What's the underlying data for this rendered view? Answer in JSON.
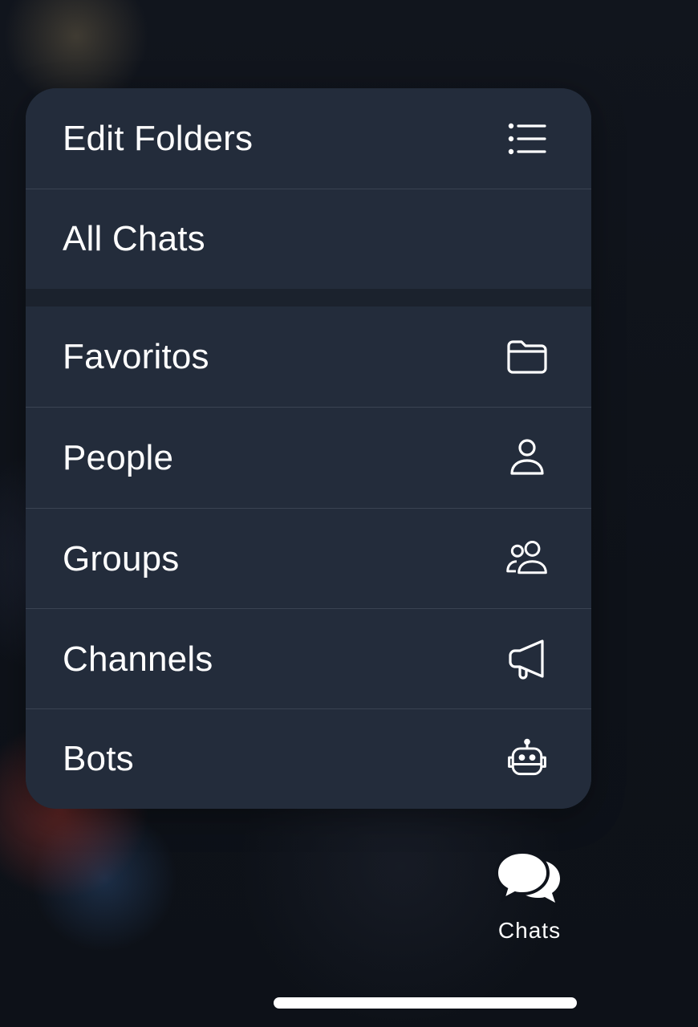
{
  "menu": {
    "items": [
      {
        "label": "Edit Folders",
        "icon": "list-icon"
      },
      {
        "label": "All Chats",
        "icon": ""
      },
      {
        "label": "Favoritos",
        "icon": "folder-icon"
      },
      {
        "label": "People",
        "icon": "person-icon"
      },
      {
        "label": "Groups",
        "icon": "group-icon"
      },
      {
        "label": "Channels",
        "icon": "megaphone-icon"
      },
      {
        "label": "Bots",
        "icon": "robot-icon"
      }
    ]
  },
  "tab_bar": {
    "chats_label": "Chats",
    "chats_icon": "chat-bubbles-icon"
  },
  "colors": {
    "menu_background": "#232c3b",
    "page_background": "#0f131b",
    "text": "#ffffff"
  }
}
